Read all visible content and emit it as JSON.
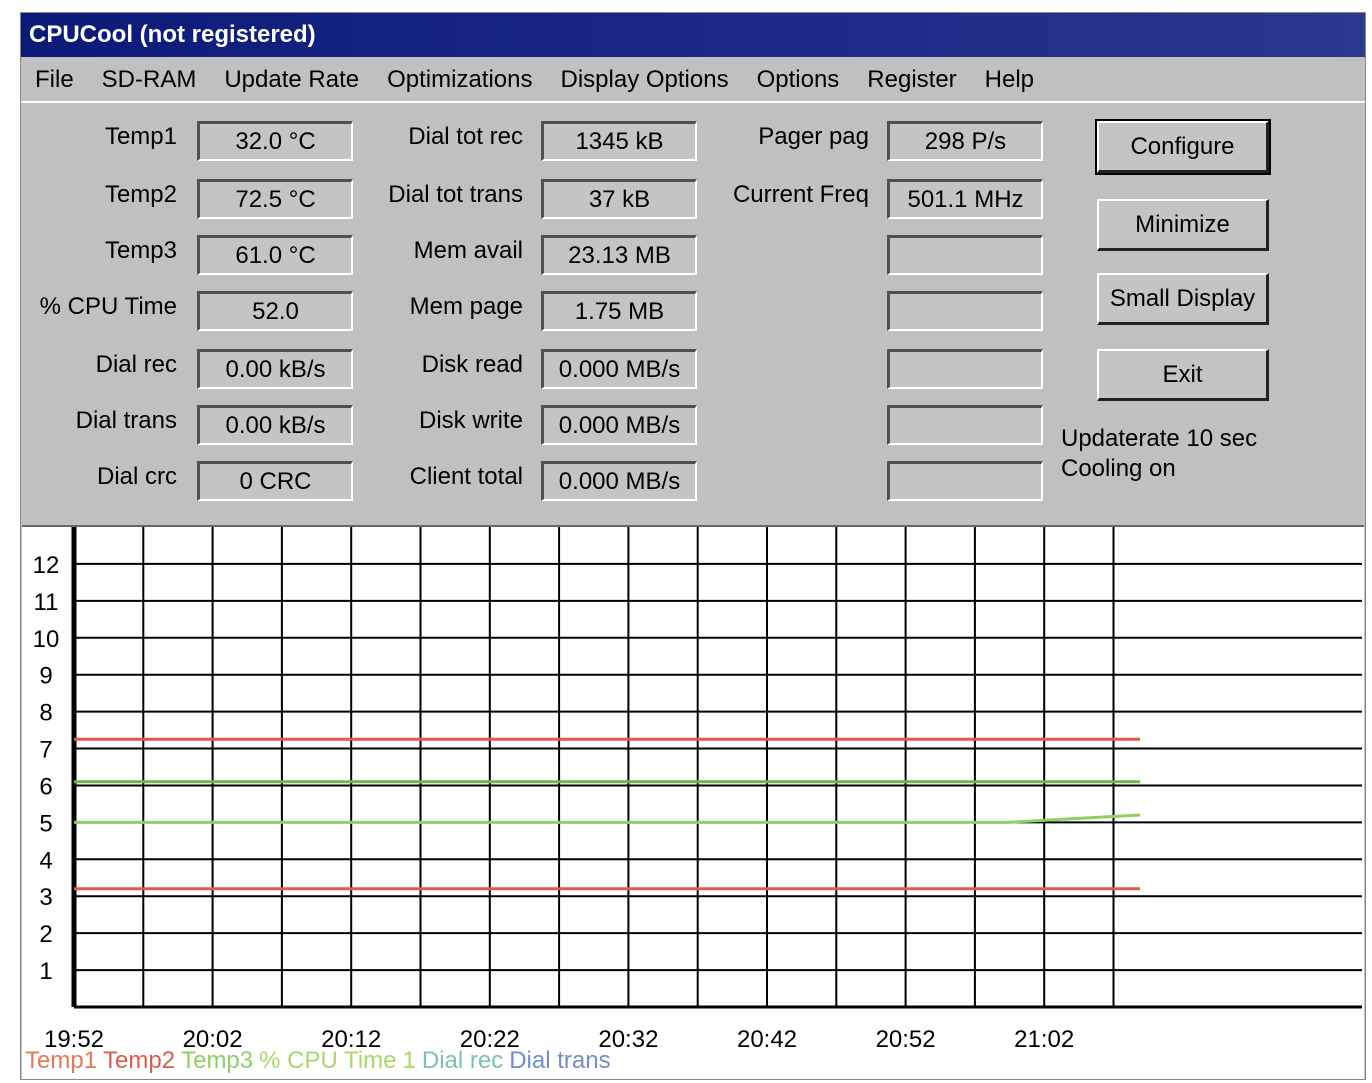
{
  "window": {
    "title": "CPUCool (not registered)"
  },
  "menu": [
    "File",
    "SD-RAM",
    "Update Rate",
    "Optimizations",
    "Display Options",
    "Options",
    "Register",
    "Help"
  ],
  "col1": [
    {
      "label": "Temp1",
      "value": "32.0 °C"
    },
    {
      "label": "Temp2",
      "value": "72.5 °C"
    },
    {
      "label": "Temp3",
      "value": "61.0 °C"
    },
    {
      "label": "% CPU Time",
      "value": "52.0"
    },
    {
      "label": "Dial rec",
      "value": "0.00 kB/s"
    },
    {
      "label": "Dial trans",
      "value": "0.00 kB/s"
    },
    {
      "label": "Dial crc",
      "value": "0 CRC"
    }
  ],
  "col2": [
    {
      "label": "Dial tot rec",
      "value": "1345 kB"
    },
    {
      "label": "Dial tot trans",
      "value": "37 kB"
    },
    {
      "label": "Mem avail",
      "value": "23.13 MB"
    },
    {
      "label": "Mem page",
      "value": "1.75 MB"
    },
    {
      "label": "Disk read",
      "value": "0.000 MB/s"
    },
    {
      "label": "Disk write",
      "value": "0.000 MB/s"
    },
    {
      "label": "Client total",
      "value": "0.000 MB/s"
    }
  ],
  "col3": [
    {
      "label": "Pager pag",
      "value": "298 P/s"
    },
    {
      "label": "Current Freq",
      "value": "501.1 MHz"
    },
    {
      "label": "",
      "value": ""
    },
    {
      "label": "",
      "value": ""
    },
    {
      "label": "",
      "value": ""
    },
    {
      "label": "",
      "value": ""
    },
    {
      "label": "",
      "value": ""
    }
  ],
  "buttons": {
    "configure": "Configure",
    "minimize": "Minimize",
    "small_display": "Small Display",
    "exit": "Exit"
  },
  "status": {
    "update_rate": "Updaterate 10 sec",
    "cooling": "Cooling on"
  },
  "chart_data": {
    "type": "line",
    "x_ticks": [
      "19:52",
      "20:02",
      "20:12",
      "20:22",
      "20:32",
      "20:42",
      "20:52",
      "21:02"
    ],
    "y_ticks": [
      "12",
      "11",
      "10",
      "9",
      "8",
      "7",
      "6",
      "5",
      "4",
      "3",
      "2",
      "1"
    ],
    "ylim": [
      0,
      13
    ],
    "grid": true,
    "legend": [
      {
        "name": "Temp1",
        "color": "#e07a5a"
      },
      {
        "name": "Temp2",
        "color": "#d6604a"
      },
      {
        "name": "Temp3",
        "color": "#8fcf6a"
      },
      {
        "name": "% CPU Time",
        "color": "#a8d868"
      },
      {
        "name": "1",
        "color": "#a8d868"
      },
      {
        "name": "Dial rec",
        "color": "#7fbfb0"
      },
      {
        "name": "Dial trans",
        "color": "#6f8fc8"
      }
    ],
    "series": [
      {
        "name": "Temp2",
        "color": "#e05a45",
        "values": [
          7.25,
          7.25,
          7.25,
          7.25,
          7.25,
          7.25,
          7.25,
          7.25,
          7.25
        ]
      },
      {
        "name": "Temp3",
        "color": "#6db84a",
        "values": [
          6.1,
          6.1,
          6.1,
          6.1,
          6.1,
          6.1,
          6.1,
          6.1,
          6.1
        ]
      },
      {
        "name": "% CPU Time",
        "color": "#8fd060",
        "values": [
          5.0,
          5.0,
          5.0,
          5.0,
          5.0,
          5.0,
          5.0,
          5.0,
          5.2
        ]
      },
      {
        "name": "Temp1",
        "color": "#e05a45",
        "values": [
          3.2,
          3.2,
          3.2,
          3.2,
          3.2,
          3.2,
          3.2,
          3.2,
          3.2
        ]
      }
    ]
  }
}
